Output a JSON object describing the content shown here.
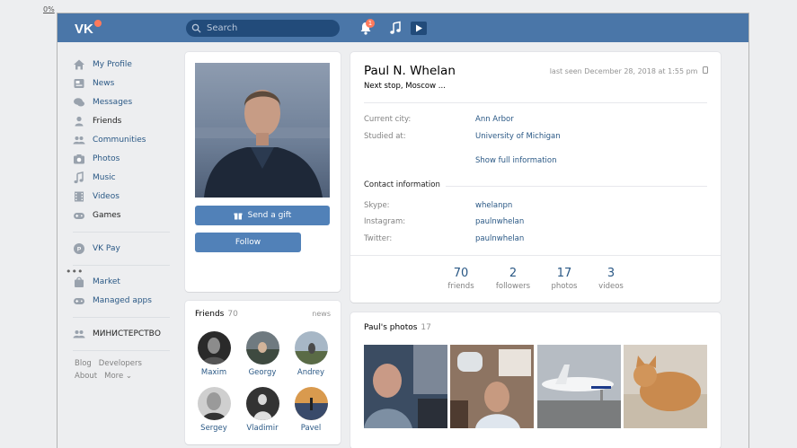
{
  "zoom": "0%",
  "search": {
    "placeholder": "Search"
  },
  "notifications": {
    "count": "1"
  },
  "nav": {
    "items": [
      {
        "label": "My Profile"
      },
      {
        "label": "News"
      },
      {
        "label": "Messages"
      },
      {
        "label": "Friends"
      },
      {
        "label": "Communities"
      },
      {
        "label": "Photos"
      },
      {
        "label": "Music"
      },
      {
        "label": "Videos"
      },
      {
        "label": "Games"
      }
    ],
    "vkpay": "VK Pay",
    "market": "Market",
    "managed_apps": "Managed apps",
    "ministry": "МИНИСТЕРСТВО",
    "footer": {
      "blog": "Blog",
      "developers": "Developers",
      "about": "About",
      "more": "More ⌄"
    }
  },
  "avatar": {
    "gift_label": "Send a gift",
    "follow_label": "Follow"
  },
  "friends": {
    "title": "Friends",
    "count": "70",
    "news_label": "news",
    "list": [
      {
        "name": "Maxim"
      },
      {
        "name": "Georgy"
      },
      {
        "name": "Andrey"
      },
      {
        "name": "Sergey"
      },
      {
        "name": "Vladimir"
      },
      {
        "name": "Pavel"
      }
    ]
  },
  "profile": {
    "name": "Paul N. Whelan",
    "status": "Next stop, Moscow ...",
    "last_seen": "last seen December 28, 2018 at 1:55 pm",
    "city_label": "Current city:",
    "city": "Ann Arbor",
    "studied_label": "Studied at:",
    "studied": "University of Michigan",
    "show_full": "Show full information",
    "contact_title": "Contact information",
    "skype_label": "Skype:",
    "skype": "whelanpn",
    "instagram_label": "Instagram:",
    "instagram": "paulnwhelan",
    "twitter_label": "Twitter:",
    "twitter": "paulnwhelan",
    "counters": [
      {
        "num": "70",
        "label": "friends"
      },
      {
        "num": "2",
        "label": "followers"
      },
      {
        "num": "17",
        "label": "photos"
      },
      {
        "num": "3",
        "label": "videos"
      }
    ]
  },
  "photos": {
    "title": "Paul's photos",
    "count": "17"
  },
  "colors": {
    "header": "#4a76a8",
    "link": "#2a5885",
    "button": "#5181b8"
  }
}
